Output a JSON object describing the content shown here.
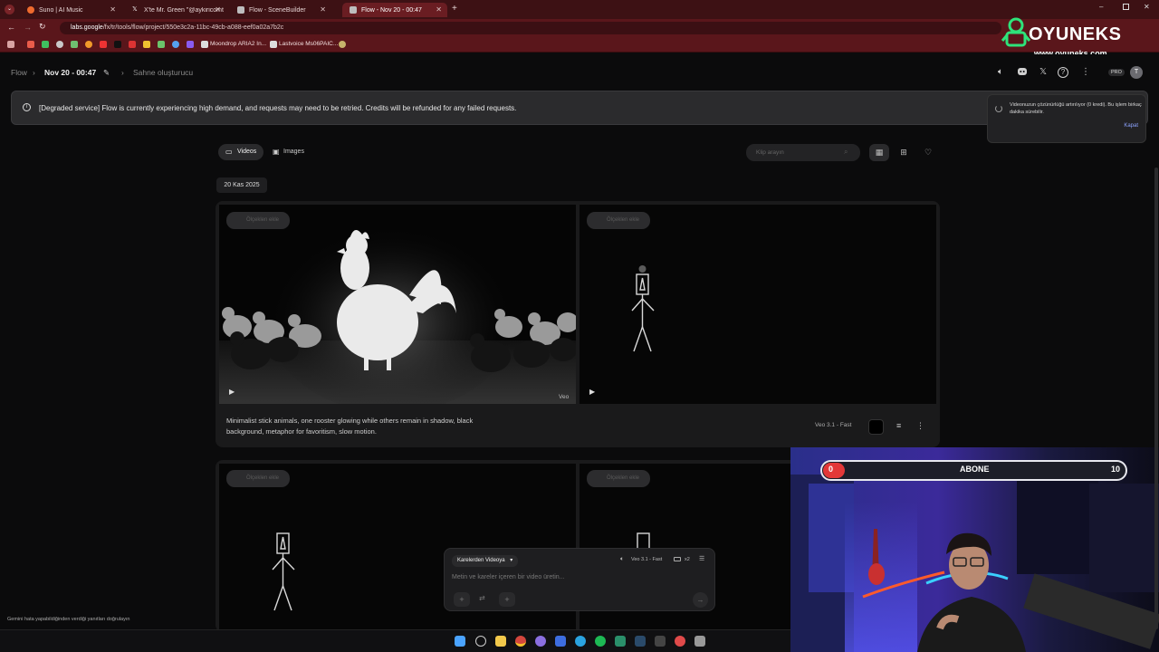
{
  "browser": {
    "tabs": [
      {
        "title": "Suno | AI Music",
        "color": "#ef6b2e"
      },
      {
        "title": "X'te Mr. Green \"@aykiricomt\"",
        "color": "#eeeeee"
      },
      {
        "title": "Flow - SceneBuilder",
        "color": "#bdbdbd"
      },
      {
        "title": "Flow - Nov 20 - 00:47",
        "color": "#bdbdbd"
      }
    ],
    "url_domain": "labs.google",
    "url_path": "/fx/tr/tools/flow/project/550e3c2a-11bc-49cb-a088-eef0a02a7b2c",
    "bookmarks": [
      "Moondrop ARIA2 In...",
      "Lastvoice Ms06PAIC..."
    ]
  },
  "app": {
    "breadcrumb_root": "Flow",
    "project_title": "Nov 20 - 00:47",
    "breadcrumb_scene": "Sahne oluşturucu",
    "plan_badge": "PRO",
    "avatar_initial": "T"
  },
  "banner": {
    "text": "[Degraded service] Flow is currently experiencing high demand, and requests may need to be retried. Credits will be refunded for any failed requests."
  },
  "toast": {
    "text": "Videonuzun çözünürlüğü artırılıyor (0 kredi). Bu işlem birkaç dakika sürebilir.",
    "close": "Kapat"
  },
  "toolbar": {
    "videos": "Videos",
    "images": "Images",
    "search_placeholder": "Klip arayın"
  },
  "date_chip": "20 Kas 2025",
  "card1": {
    "chip": "Ölçeklen ekle",
    "chip2": "Ölçeklen ekle",
    "veo_tag": "Veo",
    "caption": "Minimalist stick animals, one rooster glowing while others remain in shadow, black background, metaphor for favoritism, slow motion.",
    "model": "Veo 3.1 - Fast"
  },
  "card2": {
    "chip": "Ölçeklen ekle",
    "chip2": "Ölçeklen ekle"
  },
  "prompt": {
    "mode": "Karelerden Videoya",
    "model": "Veo 3.1 - Fast",
    "count": "x2",
    "placeholder": "Metin ve kareler içeren bir video üretin..."
  },
  "footer_note": "Gemini hata yapabildiğinden verdiği yanıtları doğrulayın",
  "overlay": {
    "sub_label": "ABONE",
    "sub_current": "0",
    "sub_goal": "10",
    "sub_progress": 0,
    "logo_text": "OYUNEKS",
    "logo_url": "www.oyuneks.com"
  },
  "colors": {
    "browser_frame": "#5a161b",
    "accent_link": "#8da4ff",
    "sub_red": "#e33838"
  }
}
